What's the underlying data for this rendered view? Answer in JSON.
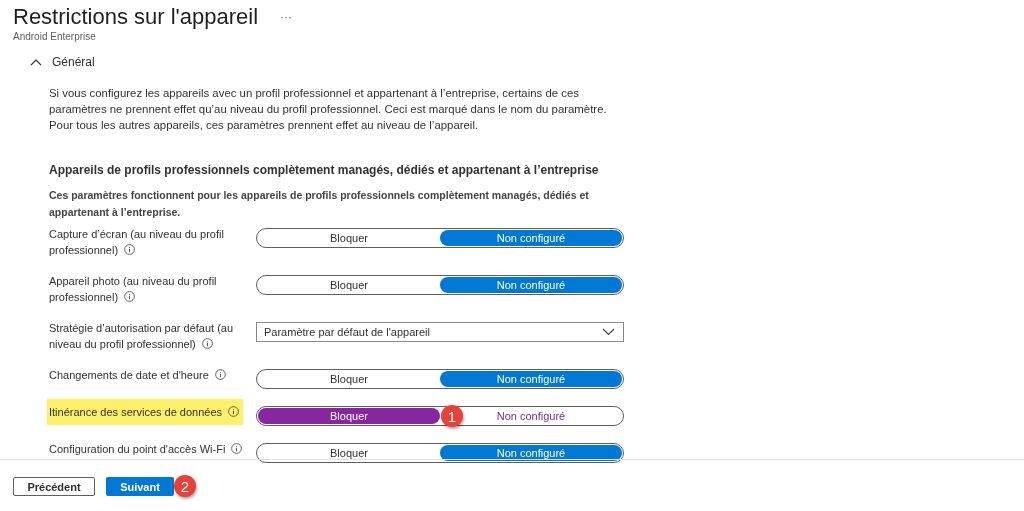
{
  "header": {
    "title": "Restrictions sur l'appareil",
    "more": "···",
    "subtitle": "Android Enterprise"
  },
  "section": {
    "title": "Général",
    "expanded": true,
    "intro": "Si vous configurez les appareils avec un profil professionnel et appartenant à l’entreprise, certains de ces paramètres ne prennent effet qu’au niveau du profil professionnel. Ceci est marqué dans le nom du paramètre. Pour tous les autres appareils, ces paramètres prennent effet au niveau de l’appareil.",
    "heading": "Appareils de profils professionnels complètement managés, dédiés et appartenant à l’entreprise",
    "description": "Ces paramètres fonctionnent pour les appareils de profils professionnels complètement managés, dédiés et appartenant à l’entreprise.",
    "settings": [
      {
        "kind": "toggle",
        "label": "Capture d’écran (au niveau du profil professionnel)",
        "highlighted": false,
        "options": [
          {
            "label": "Bloquer",
            "selected": false
          },
          {
            "label": "Non configuré",
            "selected": true
          }
        ]
      },
      {
        "kind": "toggle",
        "label": "Appareil photo (au niveau du profil professionnel)",
        "highlighted": false,
        "options": [
          {
            "label": "Bloquer",
            "selected": false
          },
          {
            "label": "Non configuré",
            "selected": true
          }
        ]
      },
      {
        "kind": "dropdown",
        "label": "Stratégie d’autorisation par défaut (au niveau du profil professionnel)",
        "highlighted": false,
        "value": "Paramètre par défaut de l'appareil"
      },
      {
        "kind": "toggle",
        "label": "Changements de date et d'heure",
        "highlighted": false,
        "options": [
          {
            "label": "Bloquer",
            "selected": false
          },
          {
            "label": "Non configuré",
            "selected": true
          }
        ]
      },
      {
        "kind": "toggle",
        "label": "Itinérance des services de données",
        "highlighted": true,
        "callout": "1",
        "options": [
          {
            "label": "Bloquer",
            "selected": true
          },
          {
            "label": "Non configuré",
            "selected": false
          }
        ]
      },
      {
        "kind": "toggle",
        "label": "Configuration du point d'accès Wi-Fi",
        "highlighted": false,
        "options": [
          {
            "label": "Bloquer",
            "selected": false
          },
          {
            "label": "Non configuré",
            "selected": true
          }
        ]
      }
    ]
  },
  "footer": {
    "previous": "Précédent",
    "next": "Suivant",
    "next_callout": "2"
  }
}
